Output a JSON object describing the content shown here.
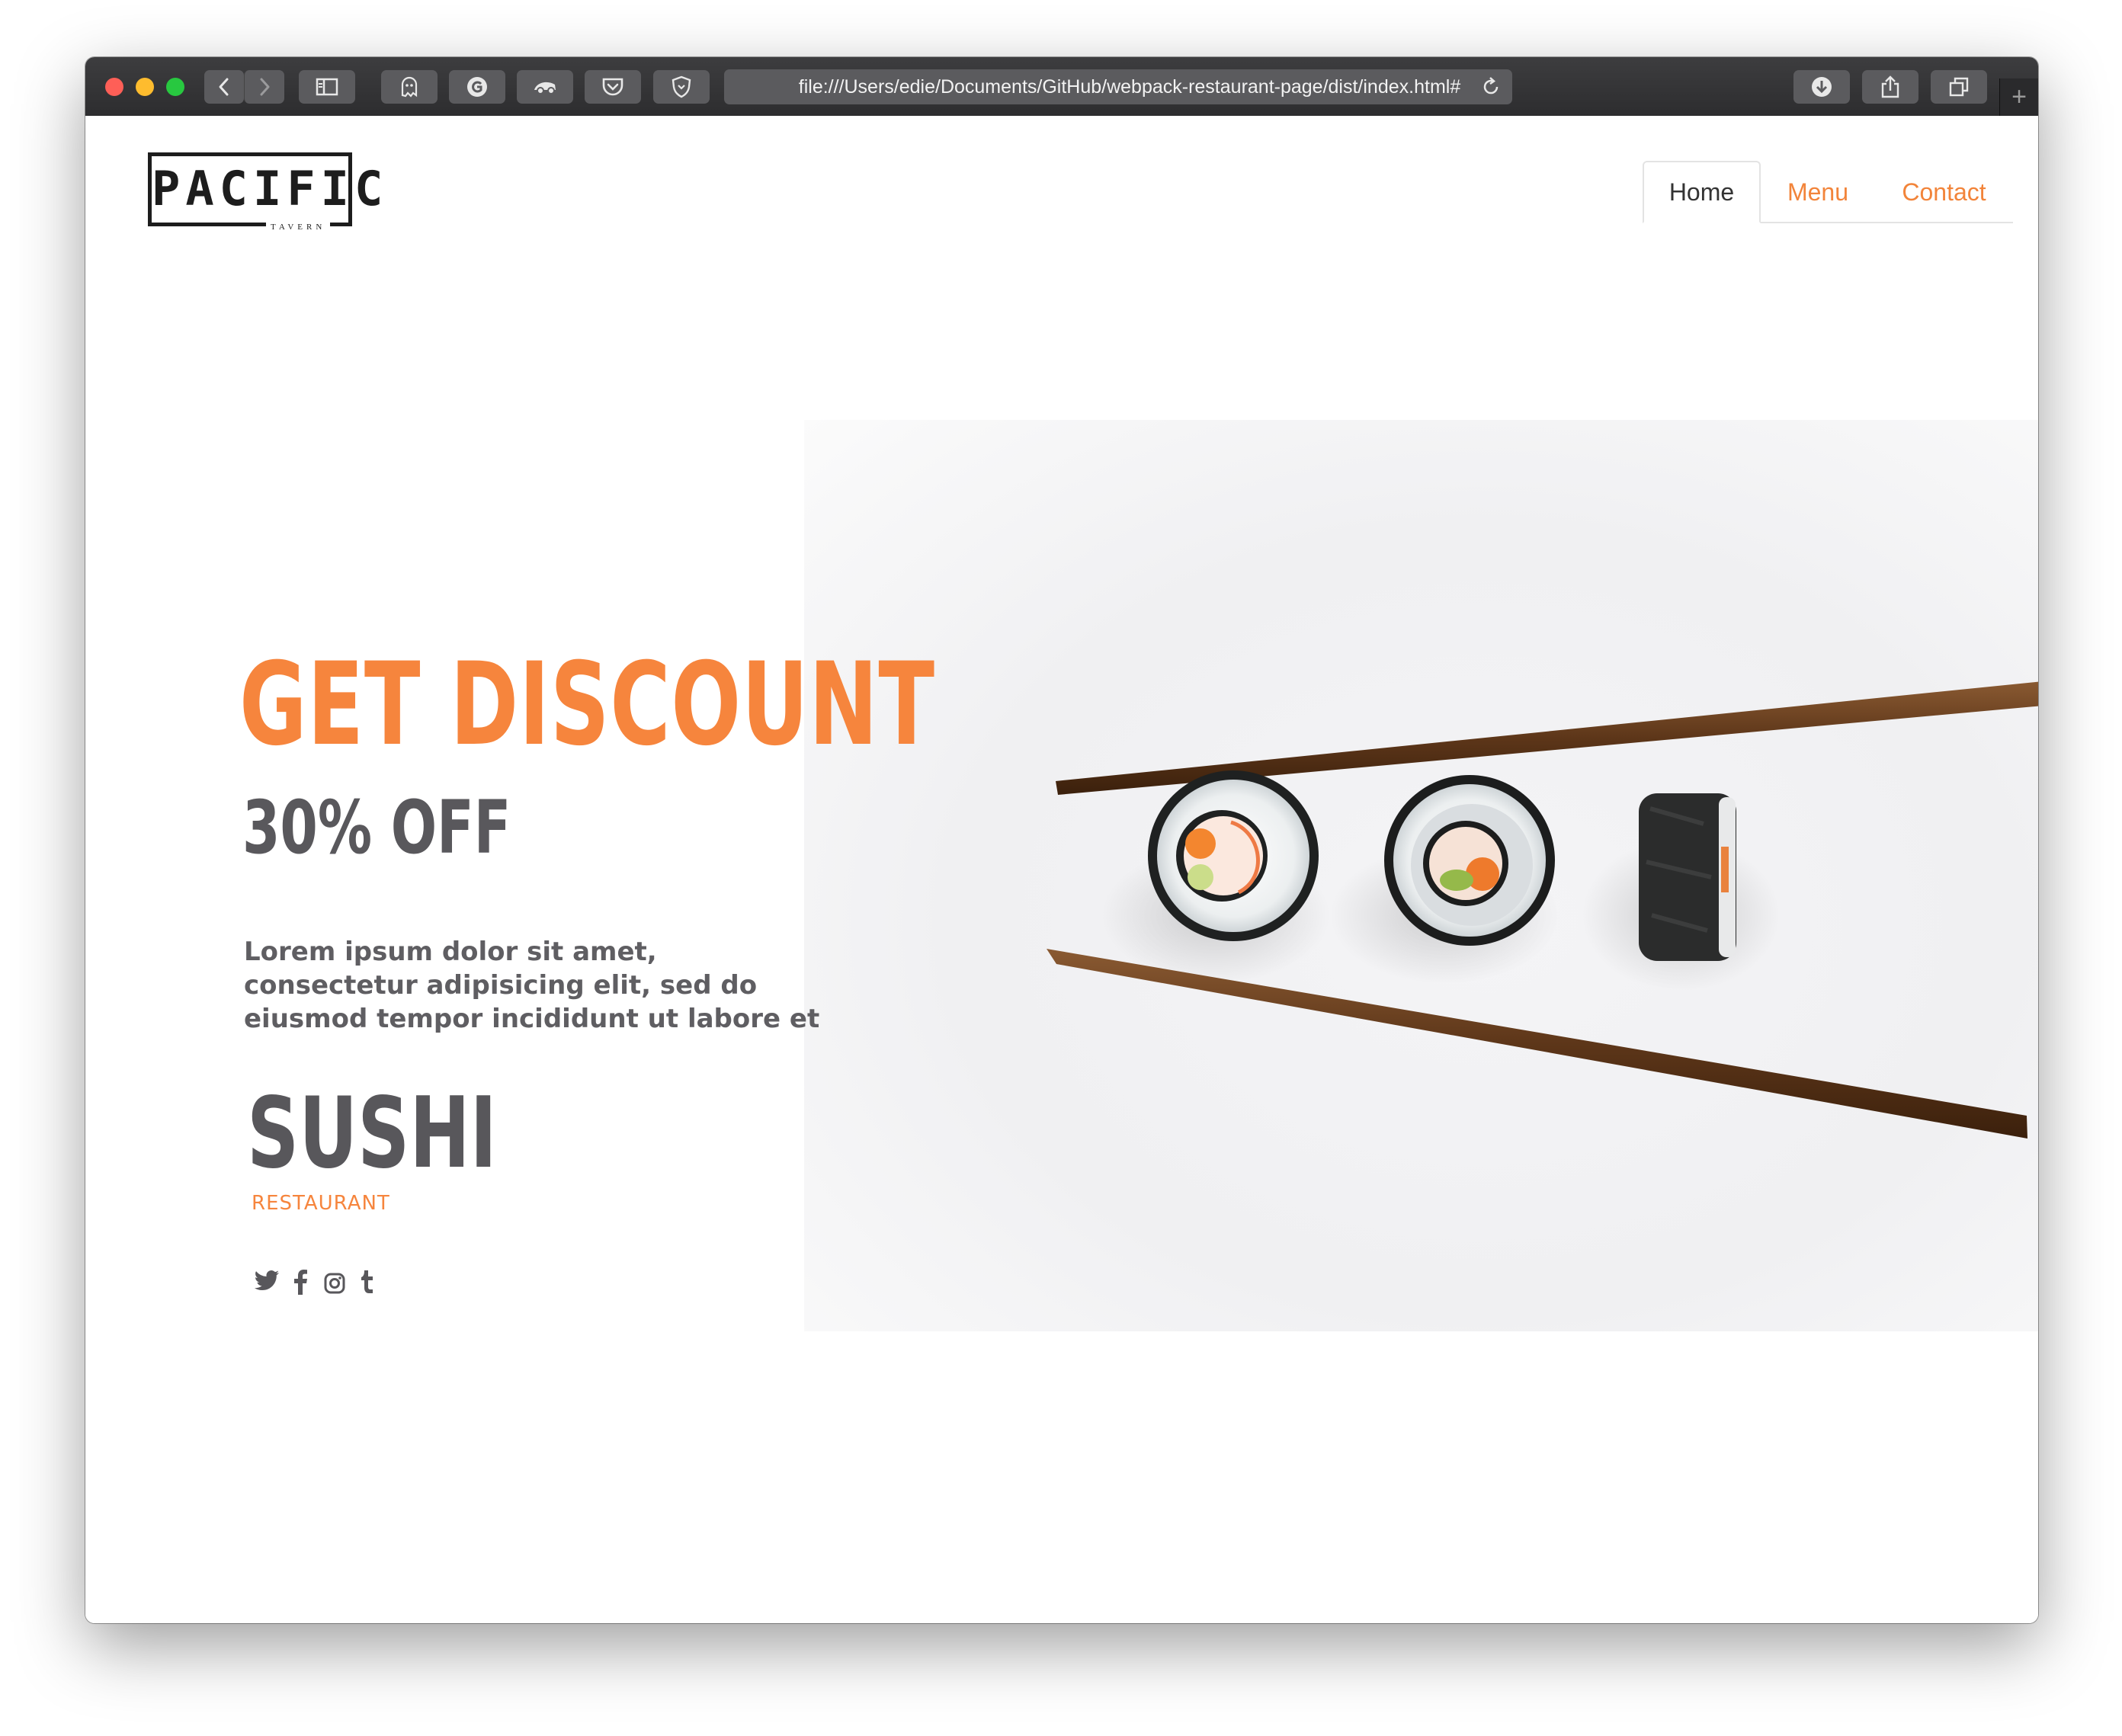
{
  "browser": {
    "url": "file:///Users/edie/Documents/GitHub/webpack-restaurant-page/dist/index.html#",
    "icons": [
      "back-icon",
      "forward-icon",
      "sidebar-icon",
      "ghostery-icon",
      "grammarly-icon",
      "extension-icon",
      "pocket-icon",
      "shield-icon",
      "reload-icon",
      "download-icon",
      "share-icon",
      "tabs-icon",
      "new-tab-icon"
    ],
    "new_tab_label": "+"
  },
  "header": {
    "logo_text": "PACIFIC",
    "logo_subtext": "TAVERN",
    "nav": [
      {
        "label": "Home",
        "active": true
      },
      {
        "label": "Menu",
        "active": false
      },
      {
        "label": "Contact",
        "active": false
      }
    ]
  },
  "hero": {
    "headline": "GET DISCOUNT",
    "offer": "30% OFF",
    "description": "Lorem ipsum dolor sit amet, consectetur adipisicing elit, sed do eiusmod tempor incididunt ut labore et",
    "title": "SUSHI",
    "subtitle": "RESTAURANT",
    "socials": [
      "twitter-icon",
      "facebook-icon",
      "instagram-icon",
      "tumblr-icon"
    ]
  },
  "colors": {
    "accent": "#f6853d",
    "text_dark": "#59585c",
    "toolbar": "#3a3a3c"
  }
}
